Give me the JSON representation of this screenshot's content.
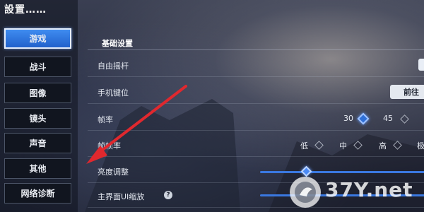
{
  "page": {
    "title": "設置……"
  },
  "sidebar": {
    "items": [
      {
        "label": "游戏",
        "active": true
      },
      {
        "label": "战斗"
      },
      {
        "label": "图像"
      },
      {
        "label": "镜头"
      },
      {
        "label": "声音"
      },
      {
        "label": "其他"
      },
      {
        "label": "网络诊断"
      }
    ]
  },
  "section": {
    "title": "基础设置"
  },
  "settings": {
    "free_joystick": {
      "label": "自由摇杆"
    },
    "phone_keys": {
      "label": "手机键位",
      "button": "前往"
    },
    "frame_rate": {
      "label": "帧率",
      "options": [
        "30",
        "45"
      ],
      "selected": "30"
    },
    "quality": {
      "label": "帧帧率",
      "options": [
        "低",
        "中",
        "高",
        "极"
      ]
    },
    "brightness": {
      "label": "亮度调整",
      "value_fraction": 0.5
    },
    "ui_scale": {
      "label": "主界面UI缩放",
      "help_icon": "?",
      "value_fraction": 0.0
    }
  },
  "annotation": {
    "arrow_color": "#e0282e"
  },
  "watermark": {
    "text": "37Y.net"
  },
  "colors": {
    "accent": "#2f6fd6",
    "arrow": "#e0282e"
  }
}
